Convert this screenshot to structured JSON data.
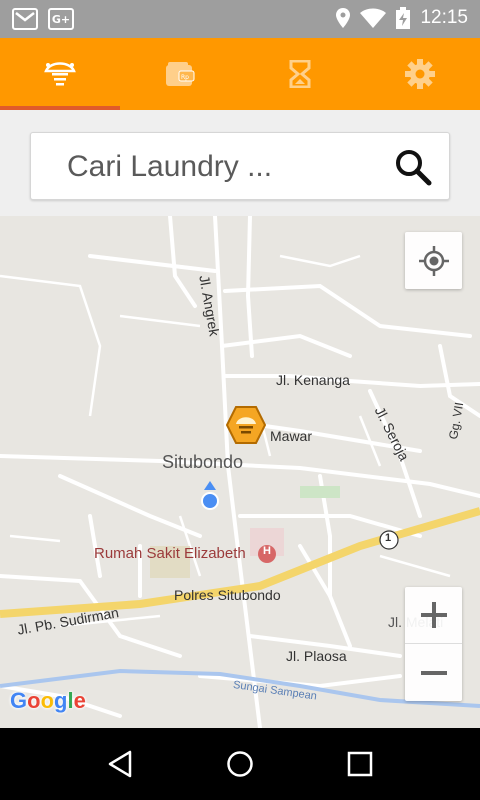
{
  "status_bar": {
    "time": "12:15",
    "icons": [
      "gmail-icon",
      "google-plus-icon",
      "location-icon",
      "wifi-icon",
      "battery-charging-icon"
    ]
  },
  "tabs": [
    {
      "name": "laundry-home",
      "icon": "laundry-logo-icon",
      "active": true
    },
    {
      "name": "wallet",
      "icon": "wallet-icon",
      "active": false
    },
    {
      "name": "history",
      "icon": "hourglass-icon",
      "active": false
    },
    {
      "name": "settings",
      "icon": "gear-icon",
      "active": false
    }
  ],
  "search": {
    "placeholder": "Cari Laundry ...",
    "value": ""
  },
  "map": {
    "labels": {
      "angrek": "Jl. Angrek",
      "kenanga": "Jl. Kenanga",
      "mawar": "Mawar",
      "seroja": "Jl. Seroja",
      "ggvii": "Gg. VII",
      "city": "Situbondo",
      "hospital": "Rumah Sakit Elizabeth",
      "police": "Polres Situbondo",
      "sudirman": "Jl. Pb. Sudirman",
      "melati": "Jl. Melati",
      "plaosa": "Jl. Plaosa",
      "river": "Sungai Sampean",
      "route": "1",
      "hospital_sign": "H"
    },
    "provider": "Google"
  },
  "colors": {
    "accent": "#ff9800",
    "active_tab_indicator": "#e05a2a",
    "status_bar": "#9e9e9e"
  }
}
